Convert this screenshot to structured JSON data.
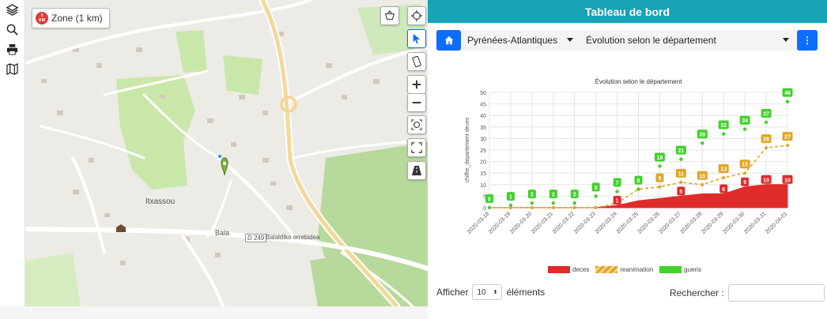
{
  "toolbar": {
    "items": [
      "layers-icon",
      "search-icon",
      "print-icon",
      "map-icon"
    ]
  },
  "map": {
    "zone_badge_top": "3",
    "zone_badge_bottom": "KM",
    "zone_label": "Zone (1 km)",
    "place_itxassou": "Itxassou",
    "road_bala": "Bala",
    "road_d249": "D 249",
    "road_balaldiko": "Balaldiko errebidea"
  },
  "panel": {
    "title": "Tableau de bord",
    "department": "Pyrénées-Atlantiques",
    "view": "Évolution selon le département",
    "menu_label": "⋮",
    "show_label": "Afficher",
    "show_value": "10",
    "elements_label": "éléments",
    "search_label": "Rechercher :"
  },
  "chart_data": {
    "type": "line",
    "title": "Évolution selon le département",
    "ylabel": "chiffre_departement deces",
    "xlabel": "",
    "ylim": [
      0,
      50
    ],
    "yticks": [
      0,
      5,
      10,
      15,
      20,
      25,
      30,
      35,
      40,
      45,
      50
    ],
    "categories": [
      "2020-03-18",
      "2020-03-19",
      "2020-03-20",
      "2020-03-21",
      "2020-03-22",
      "2020-03-23",
      "2020-03-24",
      "2020-03-25",
      "2020-03-26",
      "2020-03-27",
      "2020-03-28",
      "2020-03-29",
      "2020-03-30",
      "2020-03-31",
      "2020-04-01"
    ],
    "series": [
      {
        "name": "deces",
        "color": "#e02b2b",
        "values": [
          0,
          0,
          0,
          0,
          0,
          0,
          1,
          3,
          4,
          5,
          6,
          6,
          9,
          10,
          10
        ]
      },
      {
        "name": "reanimation",
        "color": "#e0a628",
        "values": [
          0,
          0,
          0,
          0,
          0,
          0,
          2,
          8,
          9,
          11,
          10,
          13,
          15,
          26,
          27
        ]
      },
      {
        "name": "gueris",
        "color": "#43d12b",
        "values": [
          0,
          1,
          2,
          2,
          2,
          5,
          7,
          8,
          18,
          21,
          28,
          32,
          34,
          37,
          46
        ]
      }
    ],
    "labels": {
      "deces": [
        null,
        null,
        null,
        null,
        null,
        null,
        1,
        null,
        null,
        5,
        null,
        6,
        9,
        10,
        10
      ],
      "reanimation": [
        null,
        null,
        null,
        null,
        null,
        null,
        null,
        null,
        9,
        11,
        10,
        13,
        15,
        26,
        27
      ],
      "gueris": [
        0,
        1,
        2,
        2,
        2,
        0,
        7,
        8,
        18,
        21,
        28,
        32,
        34,
        37,
        46
      ]
    },
    "legend_position": "bottom"
  }
}
